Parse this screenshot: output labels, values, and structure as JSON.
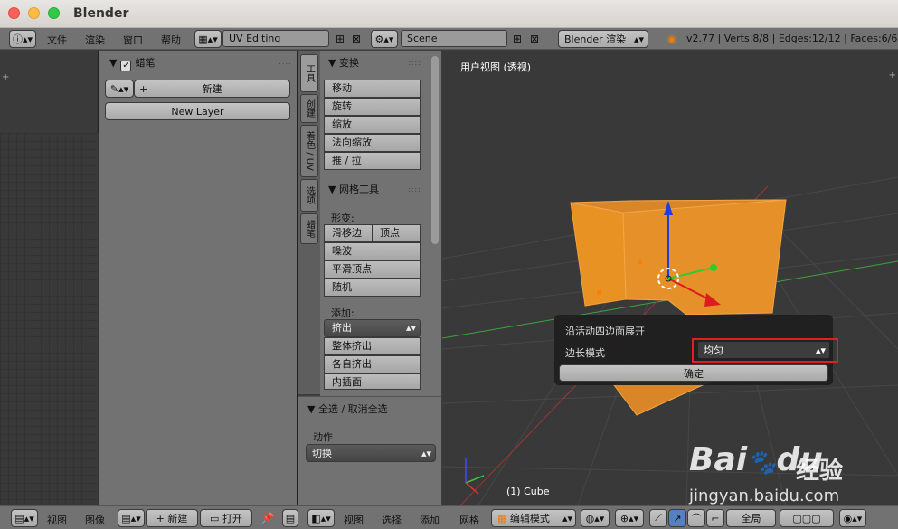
{
  "window": {
    "title": "Blender"
  },
  "topbar": {
    "menu": [
      "文件",
      "渲染",
      "窗口",
      "帮助"
    ],
    "screen_layout": "UV Editing",
    "scene": "Scene",
    "render_engine": "Blender 渲染",
    "stats": "v2.77 | Verts:8/8 | Edges:12/12 | Faces:6/6 | T"
  },
  "grease_pencil": {
    "panel_title": "蜡笔",
    "new_label": "新建",
    "new_layer_label": "New Layer"
  },
  "tool_tabs": [
    "工具",
    "创建",
    "着色 / UV",
    "选项",
    "蜡笔"
  ],
  "toolshelf": {
    "transform_title": "变换",
    "transform_buttons": [
      "移动",
      "旋转",
      "缩放",
      "法向缩放",
      "推 / 拉"
    ],
    "mesh_tools_title": "网格工具",
    "deform_label": "形变:",
    "slide_edge": "滑移边",
    "vertex": "顶点",
    "deform_buttons": [
      "噪波",
      "平滑顶点",
      "随机"
    ],
    "add_label": "添加:",
    "extrude": "挤出",
    "add_buttons": [
      "整体挤出",
      "各自挤出",
      "内插面"
    ]
  },
  "operator": {
    "title": "全选 / 取消全选",
    "action_label": "动作",
    "action_value": "切换"
  },
  "viewport": {
    "view_label": "用户视图 (透视)",
    "object_label": "(1) Cube"
  },
  "popup": {
    "title": "沿活动四边面展开",
    "edge_mode_label": "边长模式",
    "edge_mode_value": "均匀",
    "confirm": "确定"
  },
  "bottombar": {
    "left_menu": [
      "视图",
      "图像"
    ],
    "new_label": "新建",
    "open_label": "打开",
    "right_menu": [
      "视图",
      "选择",
      "添加",
      "网格"
    ],
    "mode": "编辑模式",
    "pivot": "全局"
  },
  "watermark": {
    "brand": "Bai",
    "brand2": "du",
    "cn": "经验",
    "url": "jingyan.baidu.com"
  },
  "colors": {
    "accent_red": "#e0201e",
    "mesh_orange": "#e89224"
  }
}
